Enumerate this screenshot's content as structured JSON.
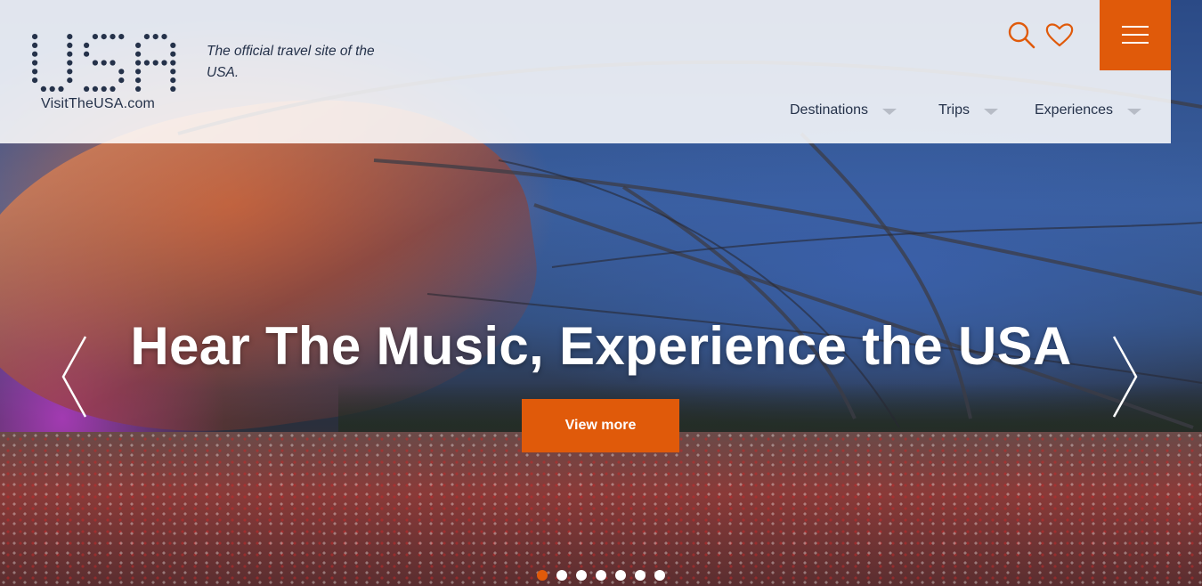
{
  "header": {
    "logo_text": "VisitTheUSA.com",
    "logo_mark": "USA",
    "tagline": "The official travel site of the USA.",
    "icons": {
      "search": "search-icon",
      "favorites": "heart-icon",
      "menu": "hamburger-menu-icon"
    },
    "nav": [
      {
        "label": "Destinations"
      },
      {
        "label": "Trips"
      },
      {
        "label": "Experiences"
      }
    ]
  },
  "hero": {
    "headline": "Hear The Music, Experience the USA",
    "cta_label": "View more",
    "prev_icon": "chevron-left-icon",
    "next_icon": "chevron-right-icon",
    "slides_total": 7,
    "active_slide": 1
  },
  "colors": {
    "accent": "#e05a0a",
    "text_dark": "#25324a",
    "header_bg": "rgba(255,255,255,0.86)",
    "white": "#ffffff"
  }
}
